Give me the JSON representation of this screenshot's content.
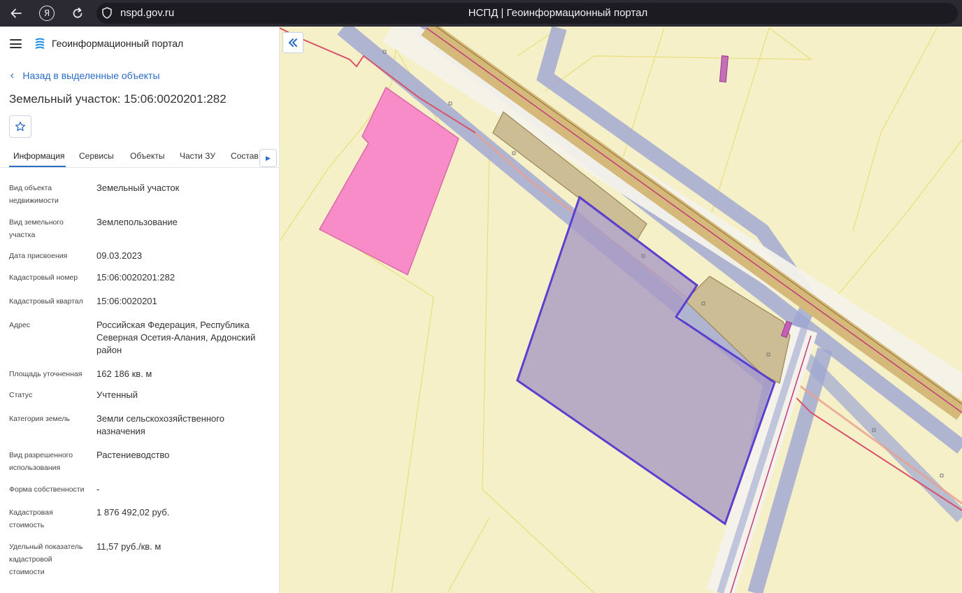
{
  "browser": {
    "url": "nspd.gov.ru",
    "title": "НСПД | Геоинформационный портал",
    "yandex_letter": "Я"
  },
  "sidebar": {
    "portal_name": "Геоинформационный портал",
    "back_label": "Назад в выделенные объекты",
    "object_title": "Земельный участок: 15:06:0020201:282",
    "tabs": [
      "Информация",
      "Сервисы",
      "Объекты",
      "Части ЗУ",
      "Состав"
    ],
    "active_tab": "Информация",
    "properties": [
      {
        "label": "Вид объекта недвижимости",
        "value": "Земельный участок"
      },
      {
        "label": "Вид земельного участка",
        "value": "Землепользование"
      },
      {
        "label": "Дата присвоения",
        "value": "09.03.2023"
      },
      {
        "label": "Кадастровый номер",
        "value": "15:06:0020201:282"
      },
      {
        "label": "Кадастровый квартал",
        "value": "15:06:0020201"
      },
      {
        "label": "Адрес",
        "value": "Российская Федерация, Республика Северная Осетия-Алания, Ардонский район"
      },
      {
        "label": "Площадь уточненная",
        "value": "162 186 кв. м"
      },
      {
        "label": "Статус",
        "value": "Учтенный"
      },
      {
        "label": "Категория земель",
        "value": "Земли сельскохозяйственного назначения"
      },
      {
        "label": "Вид разрешенного использования",
        "value": "Растениеводство"
      },
      {
        "label": "Форма собственности",
        "value": "-"
      },
      {
        "label": "Кадастровая стоимость",
        "value": "1 876 492,02 руб."
      },
      {
        "label": "Удельный показатель кадастровой стоимости",
        "value": "11,57 руб./кв. м"
      }
    ]
  },
  "colors": {
    "accent": "#2b6cc4",
    "map_background": "#f6f0c8",
    "selected_parcel_fill": "#b5a9c9",
    "selected_parcel_stroke": "#5b3fd0",
    "pink_parcel": "#f78cc9",
    "road_band": "#d4b97a",
    "utility_band": "#9ea6d2"
  },
  "icons": {
    "back": "arrow-left-icon",
    "reload": "reload-icon",
    "security": "shield-icon",
    "menu": "hamburger-icon",
    "favorite": "star-icon",
    "collapse": "double-chevron-left-icon"
  }
}
